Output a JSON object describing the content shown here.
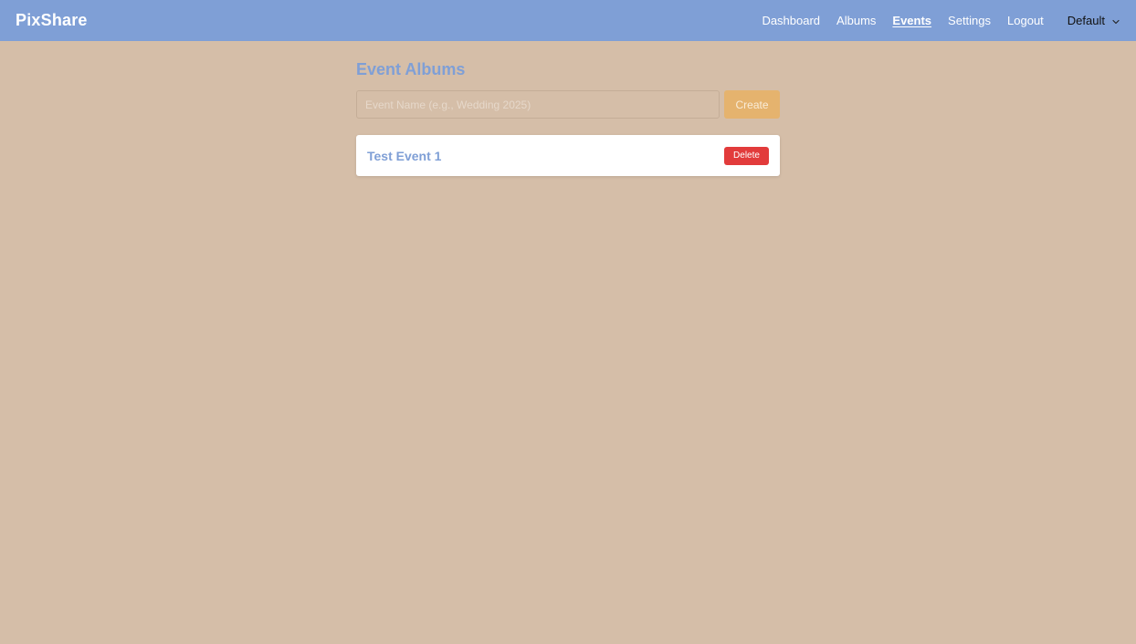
{
  "app": {
    "brand": "PixShare"
  },
  "nav": {
    "items": [
      {
        "label": "Dashboard",
        "active": false
      },
      {
        "label": "Albums",
        "active": false
      },
      {
        "label": "Events",
        "active": true
      },
      {
        "label": "Settings",
        "active": false
      },
      {
        "label": "Logout",
        "active": false
      }
    ],
    "theme_selected": "Default",
    "theme_icon": "chevron-down-icon"
  },
  "page": {
    "title": "Event Albums"
  },
  "create_form": {
    "input_value": "",
    "input_placeholder": "Event Name (e.g., Wedding 2025)",
    "create_label": "Create"
  },
  "events": [
    {
      "name": "Test Event 1",
      "delete_label": "Delete"
    }
  ],
  "colors": {
    "background": "#d5bea8",
    "topbar": "#7f9fd6",
    "accent_blue": "#7f9fd6",
    "create_button": "#e5b36e",
    "delete_button": "#e23b3b",
    "card": "#ffffff"
  }
}
